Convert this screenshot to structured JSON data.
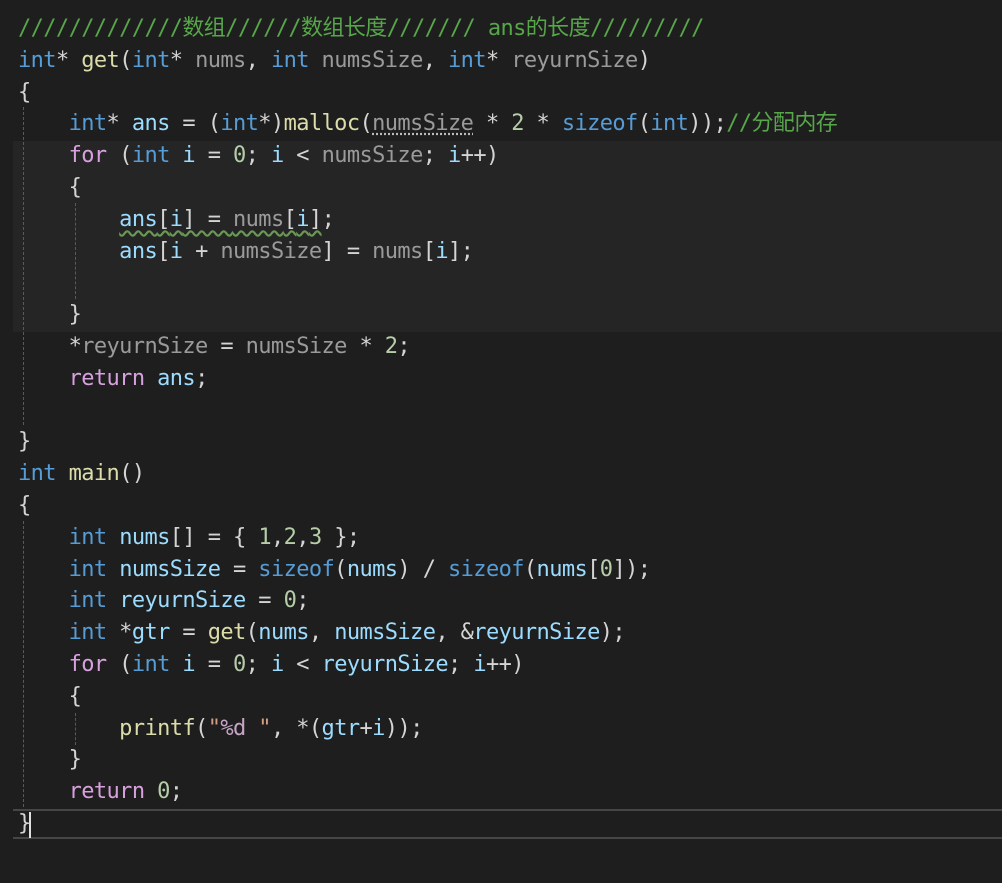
{
  "editor": {
    "lines": [
      [
        {
          "t": "/////////////数组//////数组长度/////// ans的长度/////////",
          "c": "comment"
        }
      ],
      [
        {
          "t": "int",
          "c": "kw"
        },
        {
          "t": "* ",
          "c": "punct"
        },
        {
          "t": "get",
          "c": "fn"
        },
        {
          "t": "(",
          "c": "punct"
        },
        {
          "t": "int",
          "c": "kw"
        },
        {
          "t": "* ",
          "c": "punct"
        },
        {
          "t": "nums",
          "c": "param"
        },
        {
          "t": ", ",
          "c": "punct"
        },
        {
          "t": "int",
          "c": "kw"
        },
        {
          "t": " ",
          "c": "punct"
        },
        {
          "t": "numsSize",
          "c": "param"
        },
        {
          "t": ", ",
          "c": "punct"
        },
        {
          "t": "int",
          "c": "kw"
        },
        {
          "t": "* ",
          "c": "punct"
        },
        {
          "t": "reyurnSize",
          "c": "param"
        },
        {
          "t": ")",
          "c": "punct"
        }
      ],
      [
        {
          "t": "{",
          "c": "punct"
        }
      ],
      [
        {
          "t": "    ",
          "c": "punct"
        },
        {
          "t": "int",
          "c": "kw"
        },
        {
          "t": "* ",
          "c": "punct"
        },
        {
          "t": "ans",
          "c": "local"
        },
        {
          "t": " = (",
          "c": "punct"
        },
        {
          "t": "int",
          "c": "kw"
        },
        {
          "t": "*)",
          "c": "punct"
        },
        {
          "t": "malloc",
          "c": "fn"
        },
        {
          "t": "(",
          "c": "punct"
        },
        {
          "t": "numsSize",
          "c": "param",
          "u": "dots"
        },
        {
          "t": " * ",
          "c": "punct"
        },
        {
          "t": "2",
          "c": "num"
        },
        {
          "t": " * ",
          "c": "punct"
        },
        {
          "t": "sizeof",
          "c": "kw"
        },
        {
          "t": "(",
          "c": "punct"
        },
        {
          "t": "int",
          "c": "kw"
        },
        {
          "t": "));",
          "c": "punct"
        },
        {
          "t": "//分配内存",
          "c": "comment"
        }
      ],
      [
        {
          "t": "    ",
          "c": "punct"
        },
        {
          "t": "for",
          "c": "ctl"
        },
        {
          "t": " (",
          "c": "punct"
        },
        {
          "t": "int",
          "c": "kw"
        },
        {
          "t": " ",
          "c": "punct"
        },
        {
          "t": "i",
          "c": "local"
        },
        {
          "t": " = ",
          "c": "punct"
        },
        {
          "t": "0",
          "c": "num"
        },
        {
          "t": "; ",
          "c": "punct"
        },
        {
          "t": "i",
          "c": "local"
        },
        {
          "t": " < ",
          "c": "punct"
        },
        {
          "t": "numsSize",
          "c": "param"
        },
        {
          "t": "; ",
          "c": "punct"
        },
        {
          "t": "i",
          "c": "local"
        },
        {
          "t": "++)",
          "c": "punct"
        }
      ],
      [
        {
          "t": "    {",
          "c": "punct"
        }
      ],
      [
        {
          "t": "        ",
          "c": "punct"
        },
        {
          "t": "ans",
          "c": "local",
          "u": "squiggle"
        },
        {
          "t": "[",
          "c": "punct",
          "u": "squiggle"
        },
        {
          "t": "i",
          "c": "local",
          "u": "squiggle"
        },
        {
          "t": "] = ",
          "c": "punct",
          "u": "squiggle"
        },
        {
          "t": "nums",
          "c": "param",
          "u": "squiggle"
        },
        {
          "t": "[",
          "c": "punct",
          "u": "squiggle"
        },
        {
          "t": "i",
          "c": "local",
          "u": "squiggle"
        },
        {
          "t": "]",
          "c": "punct",
          "u": "squiggle"
        },
        {
          "t": ";",
          "c": "punct"
        }
      ],
      [
        {
          "t": "        ",
          "c": "punct"
        },
        {
          "t": "ans",
          "c": "local"
        },
        {
          "t": "[",
          "c": "punct"
        },
        {
          "t": "i",
          "c": "local"
        },
        {
          "t": " + ",
          "c": "punct"
        },
        {
          "t": "numsSize",
          "c": "param"
        },
        {
          "t": "] = ",
          "c": "punct"
        },
        {
          "t": "nums",
          "c": "param"
        },
        {
          "t": "[",
          "c": "punct"
        },
        {
          "t": "i",
          "c": "local"
        },
        {
          "t": "];",
          "c": "punct"
        }
      ],
      [],
      [
        {
          "t": "    }",
          "c": "punct"
        }
      ],
      [
        {
          "t": "    *",
          "c": "punct"
        },
        {
          "t": "reyurnSize",
          "c": "param"
        },
        {
          "t": " = ",
          "c": "punct"
        },
        {
          "t": "numsSize",
          "c": "param"
        },
        {
          "t": " * ",
          "c": "punct"
        },
        {
          "t": "2",
          "c": "num"
        },
        {
          "t": ";",
          "c": "punct"
        }
      ],
      [
        {
          "t": "    ",
          "c": "punct"
        },
        {
          "t": "return",
          "c": "ctl"
        },
        {
          "t": " ",
          "c": "punct"
        },
        {
          "t": "ans",
          "c": "local"
        },
        {
          "t": ";",
          "c": "punct"
        }
      ],
      [],
      [
        {
          "t": "}",
          "c": "punct"
        }
      ],
      [
        {
          "t": "int",
          "c": "kw"
        },
        {
          "t": " ",
          "c": "punct"
        },
        {
          "t": "main",
          "c": "fn"
        },
        {
          "t": "()",
          "c": "punct"
        }
      ],
      [
        {
          "t": "{",
          "c": "punct"
        }
      ],
      [
        {
          "t": "    ",
          "c": "punct"
        },
        {
          "t": "int",
          "c": "kw"
        },
        {
          "t": " ",
          "c": "punct"
        },
        {
          "t": "nums",
          "c": "local"
        },
        {
          "t": "[] = { ",
          "c": "punct"
        },
        {
          "t": "1",
          "c": "num"
        },
        {
          "t": ",",
          "c": "punct"
        },
        {
          "t": "2",
          "c": "num"
        },
        {
          "t": ",",
          "c": "punct"
        },
        {
          "t": "3",
          "c": "num"
        },
        {
          "t": " };",
          "c": "punct"
        }
      ],
      [
        {
          "t": "    ",
          "c": "punct"
        },
        {
          "t": "int",
          "c": "kw"
        },
        {
          "t": " ",
          "c": "punct"
        },
        {
          "t": "numsSize",
          "c": "local"
        },
        {
          "t": " = ",
          "c": "punct"
        },
        {
          "t": "sizeof",
          "c": "kw"
        },
        {
          "t": "(",
          "c": "punct"
        },
        {
          "t": "nums",
          "c": "local"
        },
        {
          "t": ") / ",
          "c": "punct"
        },
        {
          "t": "sizeof",
          "c": "kw"
        },
        {
          "t": "(",
          "c": "punct"
        },
        {
          "t": "nums",
          "c": "local"
        },
        {
          "t": "[",
          "c": "punct"
        },
        {
          "t": "0",
          "c": "num"
        },
        {
          "t": "]);",
          "c": "punct"
        }
      ],
      [
        {
          "t": "    ",
          "c": "punct"
        },
        {
          "t": "int",
          "c": "kw"
        },
        {
          "t": " ",
          "c": "punct"
        },
        {
          "t": "reyurnSize",
          "c": "local"
        },
        {
          "t": " = ",
          "c": "punct"
        },
        {
          "t": "0",
          "c": "num"
        },
        {
          "t": ";",
          "c": "punct"
        }
      ],
      [
        {
          "t": "    ",
          "c": "punct"
        },
        {
          "t": "int",
          "c": "kw"
        },
        {
          "t": " *",
          "c": "punct"
        },
        {
          "t": "gtr",
          "c": "local"
        },
        {
          "t": " = ",
          "c": "punct"
        },
        {
          "t": "get",
          "c": "fn"
        },
        {
          "t": "(",
          "c": "punct"
        },
        {
          "t": "nums",
          "c": "local"
        },
        {
          "t": ", ",
          "c": "punct"
        },
        {
          "t": "numsSize",
          "c": "local"
        },
        {
          "t": ", &",
          "c": "punct"
        },
        {
          "t": "reyurnSize",
          "c": "local"
        },
        {
          "t": ");",
          "c": "punct"
        }
      ],
      [
        {
          "t": "    ",
          "c": "punct"
        },
        {
          "t": "for",
          "c": "ctl"
        },
        {
          "t": " (",
          "c": "punct"
        },
        {
          "t": "int",
          "c": "kw"
        },
        {
          "t": " ",
          "c": "punct"
        },
        {
          "t": "i",
          "c": "local"
        },
        {
          "t": " = ",
          "c": "punct"
        },
        {
          "t": "0",
          "c": "num"
        },
        {
          "t": "; ",
          "c": "punct"
        },
        {
          "t": "i",
          "c": "local"
        },
        {
          "t": " < ",
          "c": "punct"
        },
        {
          "t": "reyurnSize",
          "c": "local"
        },
        {
          "t": "; ",
          "c": "punct"
        },
        {
          "t": "i",
          "c": "local"
        },
        {
          "t": "++)",
          "c": "punct"
        }
      ],
      [
        {
          "t": "    {",
          "c": "punct"
        }
      ],
      [
        {
          "t": "        ",
          "c": "punct"
        },
        {
          "t": "printf",
          "c": "fn"
        },
        {
          "t": "(",
          "c": "punct"
        },
        {
          "t": "\"",
          "c": "str"
        },
        {
          "t": "%d",
          "c": "fmt"
        },
        {
          "t": " \"",
          "c": "str"
        },
        {
          "t": ", *(",
          "c": "punct"
        },
        {
          "t": "gtr",
          "c": "local"
        },
        {
          "t": "+",
          "c": "punct"
        },
        {
          "t": "i",
          "c": "local"
        },
        {
          "t": "));",
          "c": "punct"
        }
      ],
      [
        {
          "t": "    }",
          "c": "punct"
        }
      ],
      [
        {
          "t": "    ",
          "c": "punct"
        },
        {
          "t": "return",
          "c": "ctl"
        },
        {
          "t": " ",
          "c": "punct"
        },
        {
          "t": "0",
          "c": "num"
        },
        {
          "t": ";",
          "c": "punct"
        }
      ],
      [
        {
          "t": "}",
          "c": "punct"
        }
      ]
    ]
  }
}
